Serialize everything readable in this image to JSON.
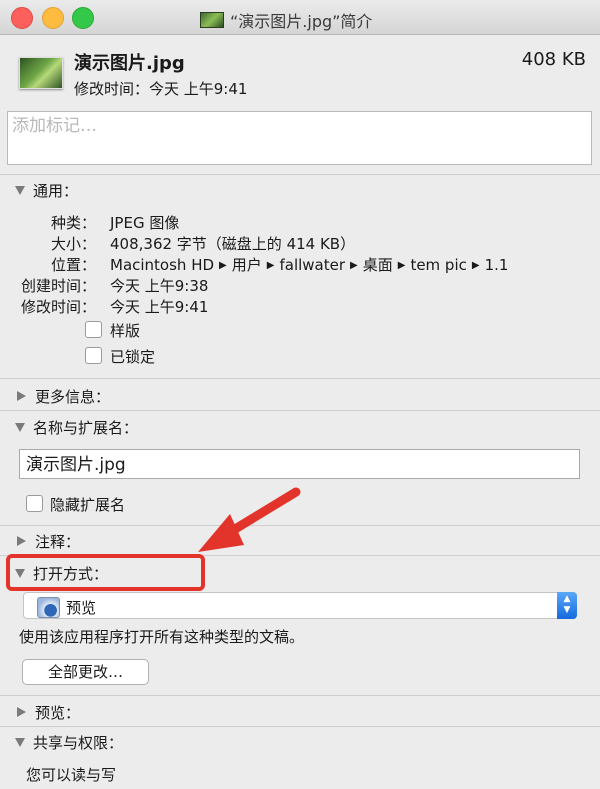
{
  "window": {
    "title": "“演示图片.jpg”简介"
  },
  "file": {
    "name": "演示图片.jpg",
    "size": "408 KB",
    "modified": "修改时间：今天 上午9:41"
  },
  "tags": {
    "placeholder": "添加标记…"
  },
  "general": {
    "title": "通用：",
    "kind_label": "种类：",
    "kind": "JPEG 图像",
    "size_label": "大小：",
    "size": "408,362 字节（磁盘上的 414 KB）",
    "where_label": "位置：",
    "path": [
      "Macintosh HD",
      "用户",
      "fallwater",
      "桌面",
      "tem pic",
      "1.1"
    ],
    "created_label": "创建时间：",
    "created": "今天 上午9:38",
    "modified_label": "修改时间：",
    "modified": "今天 上午9:41",
    "stationery_label": "样版",
    "locked_label": "已锁定"
  },
  "more_info": {
    "title": "更多信息："
  },
  "name_ext": {
    "title": "名称与扩展名：",
    "value": "演示图片.jpg",
    "hide_ext_label": "隐藏扩展名"
  },
  "comments": {
    "title": "注释："
  },
  "open_with": {
    "title": "打开方式：",
    "app": "预览",
    "desc": "使用该应用程序打开所有这种类型的文稿。",
    "change_all": "全部更改…"
  },
  "preview": {
    "title": "预览："
  },
  "sharing": {
    "title": "共享与权限：",
    "status": "您可以读与写"
  },
  "colors": {
    "highlight": "#e2342a",
    "accent": "#1569e0"
  }
}
